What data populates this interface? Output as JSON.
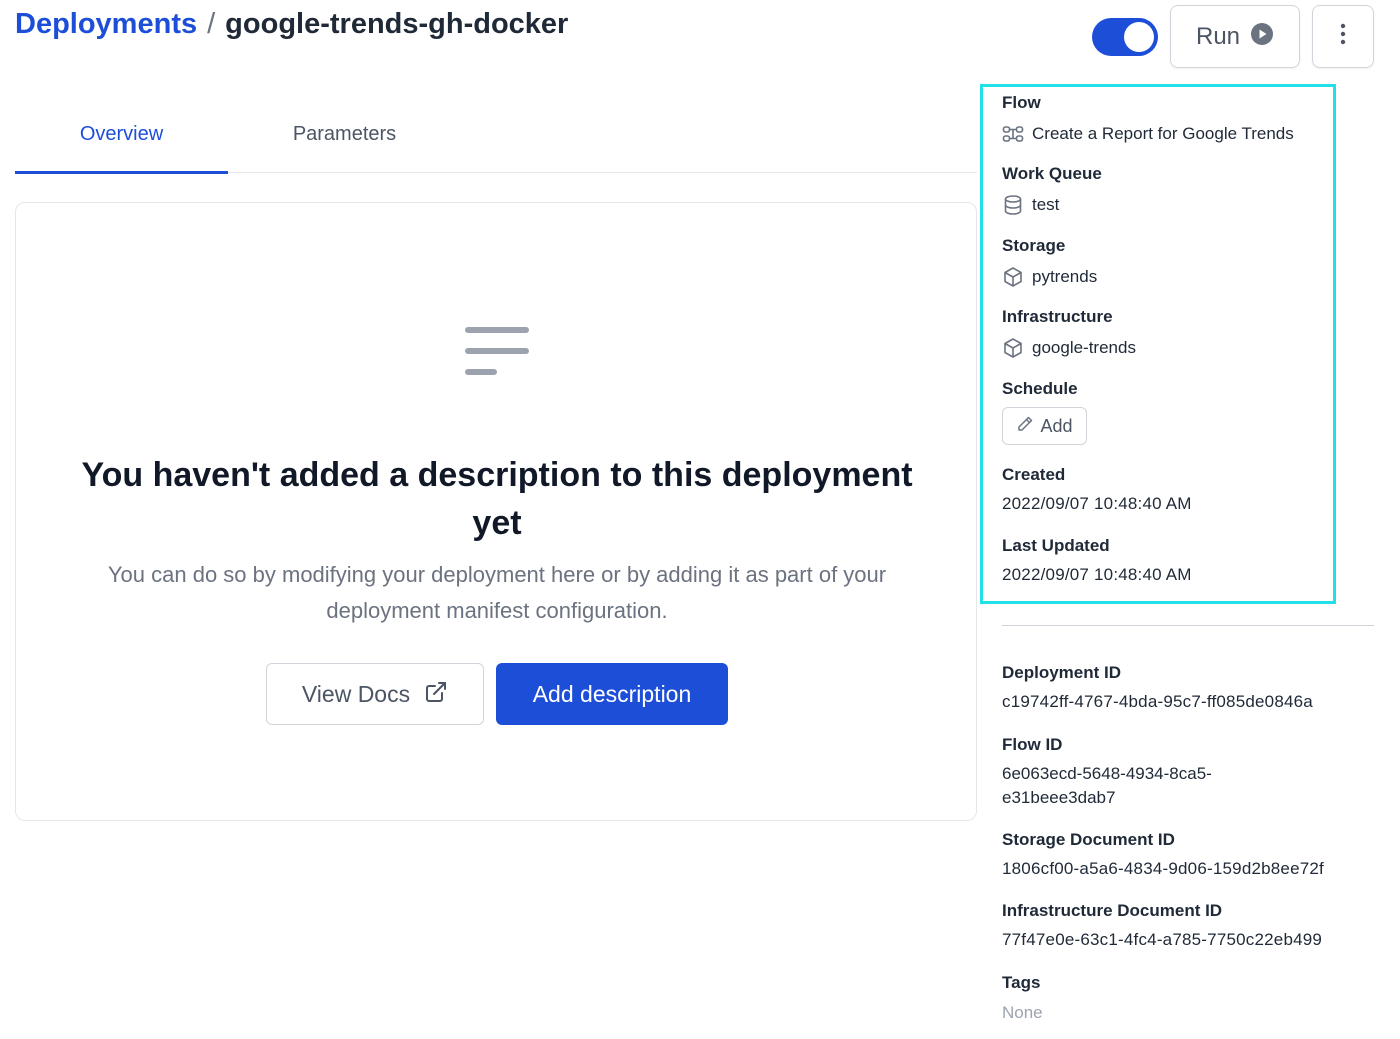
{
  "header": {
    "breadcrumb_root": "Deployments",
    "breadcrumb_separator": "/",
    "breadcrumb_current": "google-trends-gh-docker",
    "toggle_on": true,
    "run_label": "Run"
  },
  "tabs": [
    {
      "label": "Overview",
      "active": true
    },
    {
      "label": "Parameters",
      "active": false
    }
  ],
  "empty_state": {
    "title": "You haven't added a description to this deployment yet",
    "subtitle": "You can do so by modifying your deployment here or by adding it as part of your deployment manifest configuration.",
    "docs_button": "View Docs",
    "add_button": "Add description"
  },
  "details": {
    "flow_label": "Flow",
    "flow_value": "Create a Report for Google Trends",
    "work_queue_label": "Work Queue",
    "work_queue_value": "test",
    "storage_label": "Storage",
    "storage_value": "pytrends",
    "infrastructure_label": "Infrastructure",
    "infrastructure_value": "google-trends",
    "schedule_label": "Schedule",
    "schedule_add": "Add",
    "created_label": "Created",
    "created_value": "2022/09/07 10:48:40 AM",
    "updated_label": "Last Updated",
    "updated_value": "2022/09/07 10:48:40 AM",
    "deployment_id_label": "Deployment ID",
    "deployment_id_value": "c19742ff-4767-4bda-95c7-ff085de0846a",
    "flow_id_label": "Flow ID",
    "flow_id_value": "6e063ecd-5648-4934-8ca5-e31beee3dab7",
    "storage_doc_label": "Storage Document ID",
    "storage_doc_value": "1806cf00-a5a6-4834-9d06-159d2b8ee72f",
    "infra_doc_label": "Infrastructure Document ID",
    "infra_doc_value": "77f47e0e-63c1-4fc4-a785-7750c22eb499",
    "tags_label": "Tags",
    "tags_value": "None"
  },
  "colors": {
    "accent": "#1d4ed8",
    "highlight": "#22e0e8",
    "muted_text": "#6b7280"
  }
}
